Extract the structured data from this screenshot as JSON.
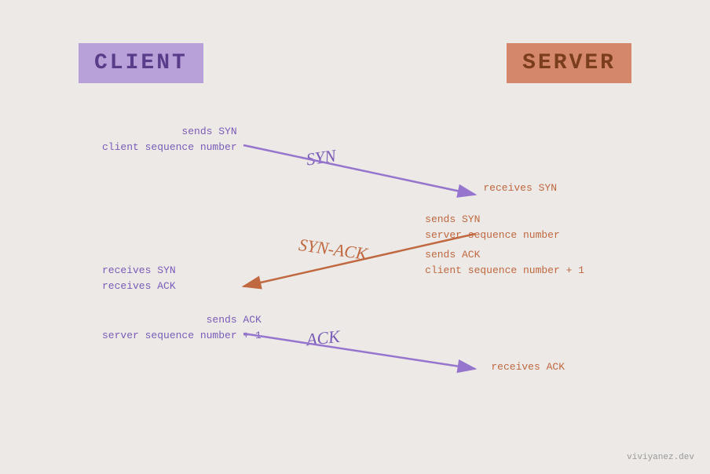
{
  "client": {
    "label": "CLIENT",
    "box_color": "#b8a0d8",
    "text_color": "#5a3d8a"
  },
  "server": {
    "label": "SERVER",
    "box_color": "#d4876a",
    "text_color": "#7a3d1e"
  },
  "steps": {
    "syn": {
      "arrow_label": "SYN",
      "client_top": "sends SYN",
      "client_bottom": "client sequence number",
      "server_top": "receives SYN"
    },
    "syn_ack": {
      "arrow_label": "SYN-ACK",
      "server_top": "sends SYN",
      "server_mid": "server sequence number",
      "server_bottom1": "sends ACK",
      "server_bottom2": "client sequence number + 1",
      "client_top": "receives SYN",
      "client_bottom": "receives ACK"
    },
    "ack": {
      "arrow_label": "ACK",
      "client_top": "sends ACK",
      "client_bottom": "server sequence number + 1",
      "server_top": "receives ACK"
    }
  },
  "watermark": "viviyanez.dev"
}
